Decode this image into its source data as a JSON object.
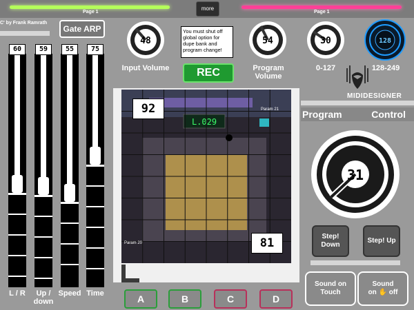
{
  "top": {
    "left_page_label": "Page 1",
    "right_page_label": "Page 1",
    "more_label": "more",
    "author_label": "C' by Frank Ramrath"
  },
  "gate_label": "Gate ARP",
  "faders": [
    {
      "label": "L / R",
      "value": "60",
      "level": 0.4
    },
    {
      "label": "Up /\ndown",
      "value": "59",
      "level": 0.39
    },
    {
      "label": "Speed",
      "value": "55",
      "level": 0.36
    },
    {
      "label": "Time",
      "value": "75",
      "level": 0.52
    }
  ],
  "knobs": {
    "input_volume": {
      "value": "48",
      "label": "Input Volume",
      "level": 0.38
    },
    "program_volume": {
      "value": "54",
      "label": "Program\nVolume",
      "level": 0.42
    },
    "range_a": {
      "value": "30",
      "label": "0-127",
      "level": 0.24
    },
    "range_b": {
      "value": "128",
      "label": "128-249",
      "level": 0.05
    }
  },
  "notice": "You must shut off global option for dupe bank and program change!",
  "rec_label": "REC",
  "xy": {
    "top_value": "92",
    "bottom_value": "81",
    "param_x_label": "Param 21",
    "param_y_label": "Param 20",
    "device_screen": "L.029"
  },
  "pads": [
    {
      "label": "A",
      "color": "#2a9e3a"
    },
    {
      "label": "B",
      "color": "#2a9e3a"
    },
    {
      "label": "C",
      "color": "#b8305a"
    },
    {
      "label": "D",
      "color": "#b8305a"
    }
  ],
  "logo": {
    "text": "MIDIDESIGNER"
  },
  "program": {
    "left_label": "Program",
    "right_label": "Control",
    "value": "31",
    "level": 0.24
  },
  "step_down_label": "Step!\nDown",
  "step_up_label": "Step! Up",
  "sound_touch_label": "Sound on\nTouch",
  "sound_off_label": "Sound\non ✋ off"
}
